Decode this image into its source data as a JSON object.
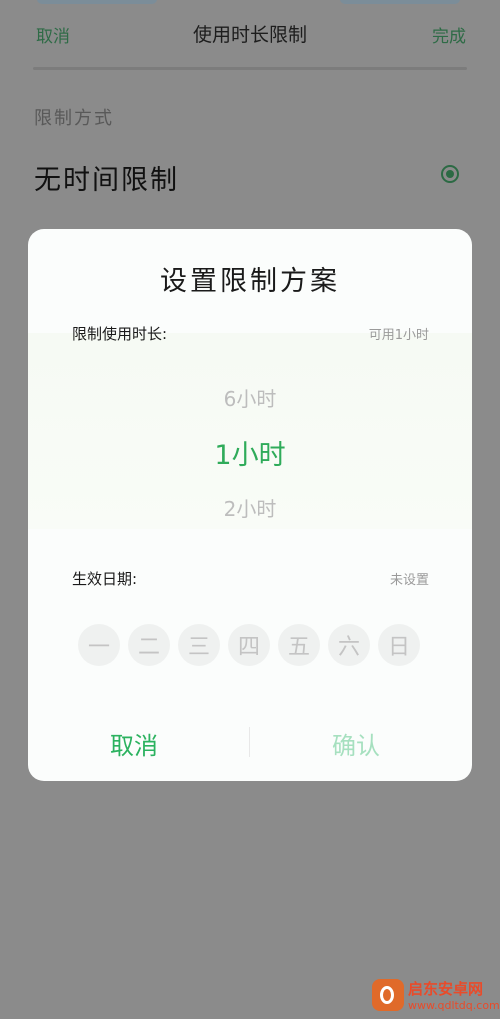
{
  "header": {
    "cancel": "取消",
    "title": "使用时长限制",
    "done": "完成"
  },
  "limit_section": {
    "label": "限制方式",
    "option": "无时间限制",
    "selected": true
  },
  "dialog": {
    "title": "设置限制方案",
    "duration_label": "限制使用时长:",
    "duration_value": "可用1小时",
    "picker": {
      "above": "6小时",
      "selected": "1小时",
      "below": "2小时"
    },
    "date_label": "生效日期:",
    "date_value": "未设置",
    "days": [
      "一",
      "二",
      "三",
      "四",
      "五",
      "六",
      "日"
    ],
    "cancel": "取消",
    "confirm": "确认"
  },
  "watermark": {
    "name": "启东安卓网",
    "url": "www.qdltdq.com"
  },
  "colors": {
    "accent": "#2fab5a",
    "confirm_disabled": "#a6e0bf",
    "overlay": "#8b8b8b"
  }
}
